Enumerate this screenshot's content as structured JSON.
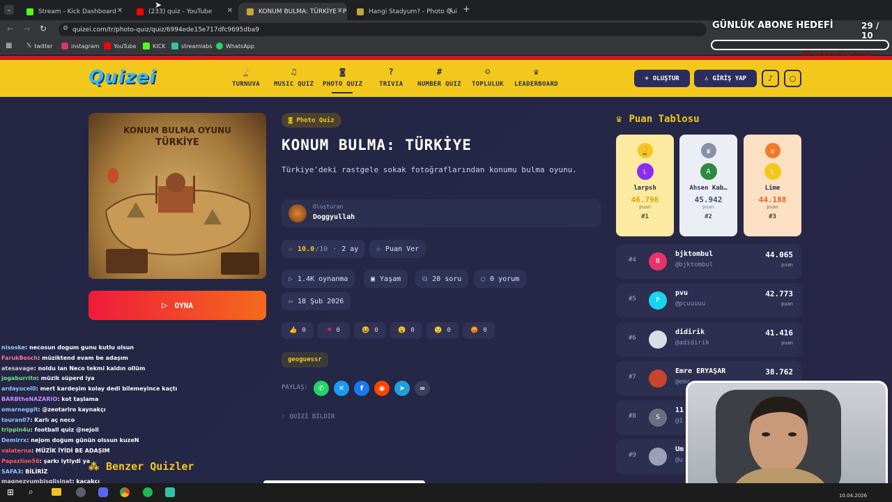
{
  "browser": {
    "tabs": [
      {
        "title": "Stream - Kick Dashboard",
        "color": "#53fc18"
      },
      {
        "title": "(233) quiz - YouTube",
        "color": "#ff0000"
      },
      {
        "title": "KONUM BULMA: TÜRKİYE - Ph",
        "color": "#c9a43a"
      },
      {
        "title": "Hangi Stadyum? - Photo Quiz",
        "color": "#c9a43a"
      }
    ],
    "url": "quizei.com/tr/photo-quiz/quiz/6994ede15e717dfc9695dba9",
    "bookmarks": [
      "twitter",
      "instagram",
      "YouTube",
      "KICK",
      "streamlabs",
      "WhatsApp"
    ]
  },
  "overlay": {
    "goal_label": "GÜNLÜK ABONE HEDEFİ",
    "goal_count": "29 / 10",
    "brand": "ByNoGame"
  },
  "site": {
    "logo": "Quizei",
    "nav": [
      {
        "label": "TURNUVA",
        "icon": "trophy-icon"
      },
      {
        "label": "MUSIC QUIZ",
        "icon": "music-icon"
      },
      {
        "label": "PHOTO QUIZ",
        "icon": "camera-icon"
      },
      {
        "label": "TRIVIA",
        "icon": "question-icon"
      },
      {
        "label": "NUMBER QUIZ",
        "icon": "hash-icon"
      },
      {
        "label": "TOPLULUK",
        "icon": "users-icon"
      },
      {
        "label": "LEADERBOARD",
        "icon": "award-icon"
      }
    ],
    "create_label": "OLUŞTUR",
    "login_label": "GİRİŞ YAP"
  },
  "quiz": {
    "cover_title_1": "KONUM BULMA OYUNU",
    "cover_title_2": "TÜRKİYE",
    "category_badge": "Photo Quiz",
    "title": "KONUM BULMA: TÜRKİYE",
    "description": "Türkiye'deki rastgele sokak fotoğraflarından konumu bulma oyunu.",
    "creator_label": "Oluşturan",
    "creator_name": "Doggyullah",
    "rating": "10.0",
    "rating_max": "/10",
    "age": "2 ay",
    "rate_label": "Puan Ver",
    "plays": "1.4K oynanma",
    "topic": "Yaşam",
    "questions": "20 soru",
    "comments": "0 yorum",
    "date": "18 Şub 2026",
    "play_label": "OYNA",
    "reactions": [
      "0",
      "0",
      "0",
      "0",
      "0",
      "0"
    ],
    "tag": "geoguessr",
    "share_label": "PAYLAŞ:",
    "report_label": "QUİZİ BİLDİR",
    "similar_label": "Benzer Quizler"
  },
  "leaderboard": {
    "title": "Puan Tablosu",
    "podium": [
      {
        "initial": "L",
        "name": "larpsh",
        "score": "46.796",
        "unit": "puan",
        "rank": "#1"
      },
      {
        "initial": "A",
        "name": "Ahsen Kab…",
        "score": "45.942",
        "unit": "puan",
        "rank": "#2"
      },
      {
        "initial": "L",
        "name": "Lime",
        "score": "44.188",
        "unit": "puan",
        "rank": "#3"
      }
    ],
    "rows": [
      {
        "rank": "#4",
        "initial": "B",
        "name": "bjktombul",
        "handle": "@bjktombul",
        "score": "44.065",
        "unit": "puan"
      },
      {
        "rank": "#5",
        "initial": "P",
        "name": "pvu",
        "handle": "@pcuuuuu",
        "score": "42.773",
        "unit": "puan"
      },
      {
        "rank": "#6",
        "initial": "",
        "name": "didirik",
        "handle": "@adidirik",
        "score": "41.416",
        "unit": "puan"
      },
      {
        "rank": "#7",
        "initial": "",
        "name": "Emre ERYAŞAR",
        "handle": "@emr",
        "score": "38.762",
        "unit": ""
      },
      {
        "rank": "#8",
        "initial": "S",
        "name": "11",
        "handle": "@1",
        "score": "",
        "unit": ""
      },
      {
        "rank": "#9",
        "initial": "",
        "name": "Um",
        "handle": "@u",
        "score": "",
        "unit": ""
      }
    ]
  },
  "chat": [
    {
      "user": "nisoske",
      "msg": ": necosun dogum gunu kutlu olsun",
      "color": "#9ad0ff"
    },
    {
      "user": "FarukBosch",
      "msg": ": müziktend evam be adaşım",
      "color": "#ff6fa0"
    },
    {
      "user": "atesavage",
      "msg": ": noldu lan Neco tekmi kaldın ollüm",
      "color": "#cfcfcf"
    },
    {
      "user": "jogaburrito",
      "msg": ": müzik süperd iya",
      "color": "#6ee27a"
    },
    {
      "user": "ardayucel0",
      "msg": ": mert kardeşim kolay dedi bilemeyince kaçtı",
      "color": "#8fc3ff"
    },
    {
      "user": "BARBtheNAZARIO",
      "msg": ": kot taşlama",
      "color": "#c98bff"
    },
    {
      "user": "omarneggit",
      "msg": ": @zeotariro kaynakçı",
      "color": "#8fc3ff"
    },
    {
      "user": "touran07",
      "msg": ": Karlı aç neco",
      "color": "#8fc3ff"
    },
    {
      "user": "trippin4u",
      "msg": ": football quiz @nejoli",
      "color": "#6ee27a"
    },
    {
      "user": "Demirrx",
      "msg": ": nejom doğum günün olssun kuzeN",
      "color": "#8fc3ff"
    },
    {
      "user": "valaterna",
      "msg": ": MÜZİK İYİDİ BE ADAŞIM",
      "color": "#ff5a5a"
    },
    {
      "user": "Papazlion56",
      "msg": ": şarkı iytiydi ya",
      "color": "#ff5a5a"
    },
    {
      "user": "SAFA3",
      "msg": ": BİLİRİZ",
      "color": "#8fc3ff"
    },
    {
      "user": "magnezyumbisglisinat",
      "msg": ": kaçakçı",
      "color": "#cfcfcf"
    }
  ],
  "taskbar": {
    "date": "10.04.2026"
  }
}
